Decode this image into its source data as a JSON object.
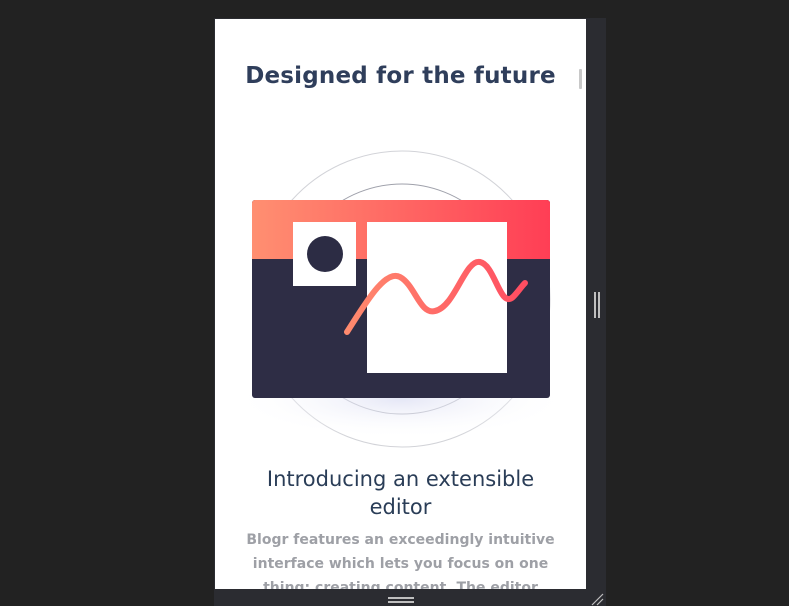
{
  "section": {
    "title": "Designed for the future"
  },
  "feature": {
    "heading": "Introducing an extensible editor",
    "body": "Blogr features an exceedingly intuitive interface which lets you focus on one thing: creating content. The editor"
  },
  "illustration": {
    "icon": "editor-illustration",
    "colors": {
      "gradient_start": "#ff8f71",
      "gradient_end": "#ff3e55",
      "dark": "#2c2c44",
      "line_start": "#ff7a6a",
      "line_end": "#ff4d61"
    }
  },
  "viewer": {
    "side_handle_icon": "vertical-drag-handle-icon",
    "bottom_handle_icon": "horizontal-drag-handle-icon",
    "corner_handle_icon": "resize-corner-icon"
  }
}
